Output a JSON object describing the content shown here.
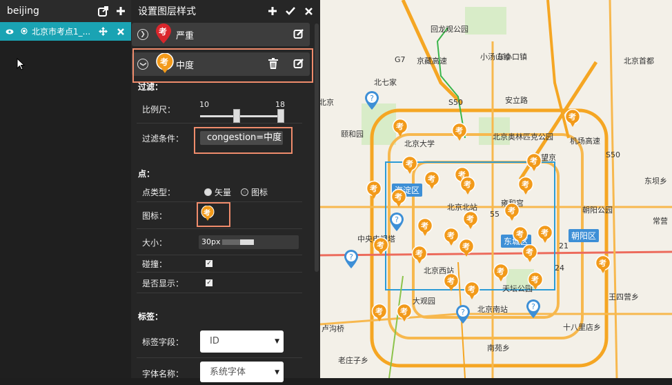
{
  "left_panel": {
    "title": "beijing",
    "layer": {
      "label": "北京市考点1_..."
    }
  },
  "style_panel": {
    "title": "设置图层样式",
    "styles": [
      {
        "name": "严重",
        "pin_text": "考",
        "pin_color": "#d9262c"
      },
      {
        "name": "中度",
        "pin_text": "考",
        "pin_color": "#f29a1a"
      }
    ],
    "filter_section": "过滤：",
    "scale_label": "比例尺：",
    "scale_min": "10",
    "scale_max": "18",
    "filter_label": "过滤条件：",
    "filter_value": "congestion=中度",
    "point_section": "点：",
    "point_type_label": "点类型：",
    "point_type_options": [
      "矢量",
      "图标"
    ],
    "icon_label": "图标：",
    "icon_text": "考",
    "size_label": "大小：",
    "size_value": "30px",
    "collision_label": "碰撞：",
    "show_label": "是否显示：",
    "label_section": "标签：",
    "label_field_label": "标签字段：",
    "label_field_value": "ID",
    "font_name_label": "字体名称：",
    "font_name_value": "系统字体"
  },
  "map": {
    "labels": [
      "回龙观公园",
      "小汤山镇",
      "北京首都",
      "东小口镇",
      "北七家",
      "北京",
      "北京大学",
      "北京奥林匹克公园",
      "望京",
      "颐和园",
      "海淀区",
      "北京北站",
      "雍和宫",
      "朝阳公园",
      "中央电视塔",
      "东城区",
      "朝阳区",
      "北京西站",
      "天坛公园",
      "王四营乡",
      "大观园",
      "北京南站",
      "十八里店乡",
      "卢沟桥",
      "南苑乡",
      "老庄子乡",
      "东坝乡",
      "常营",
      "安立路",
      "京藏高速",
      "机场高速",
      "G7",
      "S50",
      "S50",
      "55",
      "21",
      "24"
    ],
    "district_labels": [
      "海淀区",
      "东城区",
      "朝阳区"
    ],
    "pin_text": "考",
    "accent": "#f29a1a"
  }
}
